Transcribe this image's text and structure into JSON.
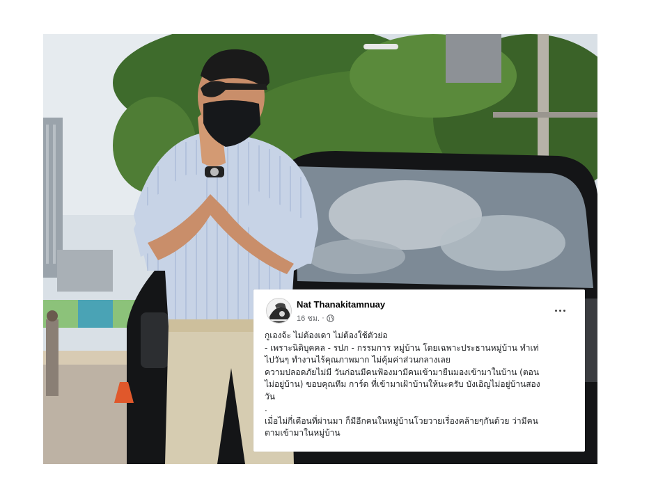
{
  "post": {
    "author_name": "Nat Thanakitamnuay",
    "time": "16 ชม.",
    "separator": "·",
    "privacy_icon": "globe-icon",
    "more_icon": "more-options-icon",
    "body_lines": [
      "กูเองจ้ะ ไม่ต้องเดา ไม่ต้องใช้ตัวย่อ",
      "- เพราะนิติบุคคล - รปภ - กรรมการ หมู่บ้าน โดยเฉพาะประธานหมู่บ้าน ทำเท่",
      "ไปวันๆ  ทำงานไร้คุณภาพมาก ไม่คุ้มค่าส่วนกลางเลย",
      "ความปลอดภัยไม่มี วันก่อนมีคนฟ้องมามีคนเข้ามายืนมองเข้ามาในบ้าน (ตอน",
      "ไม่อยู่บ้าน) ขอบคุณทีม การ์ด ที่เข้ามาเฝ้าบ้านให้นะครับ บังเอิญไม่อยู่บ้านสอง",
      "วัน",
      ".",
      "เมื่อไม่กี่เดือนที่ผ่านมา ก็มีอีกคนในหมู่บ้านโวยวายเรื่องคล้ายๆกันด้วย ว่ามีคน",
      "ตามเข้ามาในหมู่บ้าน"
    ]
  },
  "colors": {
    "name": "#050505",
    "meta": "#65676b",
    "body": "#1c1e21",
    "card_bg": "#ffffff"
  }
}
